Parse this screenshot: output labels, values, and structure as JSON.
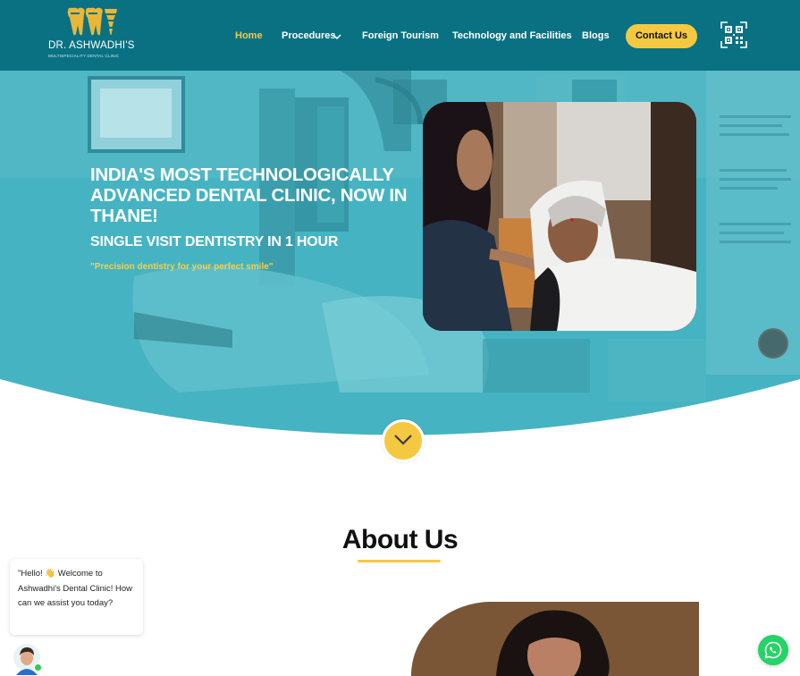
{
  "brand": {
    "name": "DR. ASHWADHI'S",
    "tagline": "MULTISPECIALITY DENTAL CLINIC",
    "logo_icon": "teeth-logo-icon"
  },
  "nav": {
    "items": [
      {
        "label": "Home",
        "active": true
      },
      {
        "label": "Procedures",
        "has_dropdown": true
      },
      {
        "label": "Foreign Tourism"
      },
      {
        "label": "Technology and Facilities"
      },
      {
        "label": "Blogs"
      }
    ],
    "contact_label": "Contact Us",
    "qr_icon": "qr-code-icon"
  },
  "hero": {
    "headline": "INDIA'S MOST TECHNOLOGICALLY ADVANCED DENTAL CLINIC, NOW IN THANE!",
    "subheadline": "SINGLE VISIT DENTISTRY IN 1 HOUR",
    "tagline": "\"Precision dentistry for your perfect smile\"",
    "scroll_icon": "chevron-down-icon"
  },
  "about": {
    "title": "About Us"
  },
  "chat": {
    "message": "\"Hello! 👋 Welcome to Ashwadhi's Dental Clinic! How can we assist you today?",
    "whatsapp_icon": "whatsapp-icon"
  },
  "colors": {
    "header_bg": "#0a7183",
    "accent": "#f5c842",
    "hero_overlay": "#3fb0c0",
    "whatsapp": "#25d366"
  }
}
